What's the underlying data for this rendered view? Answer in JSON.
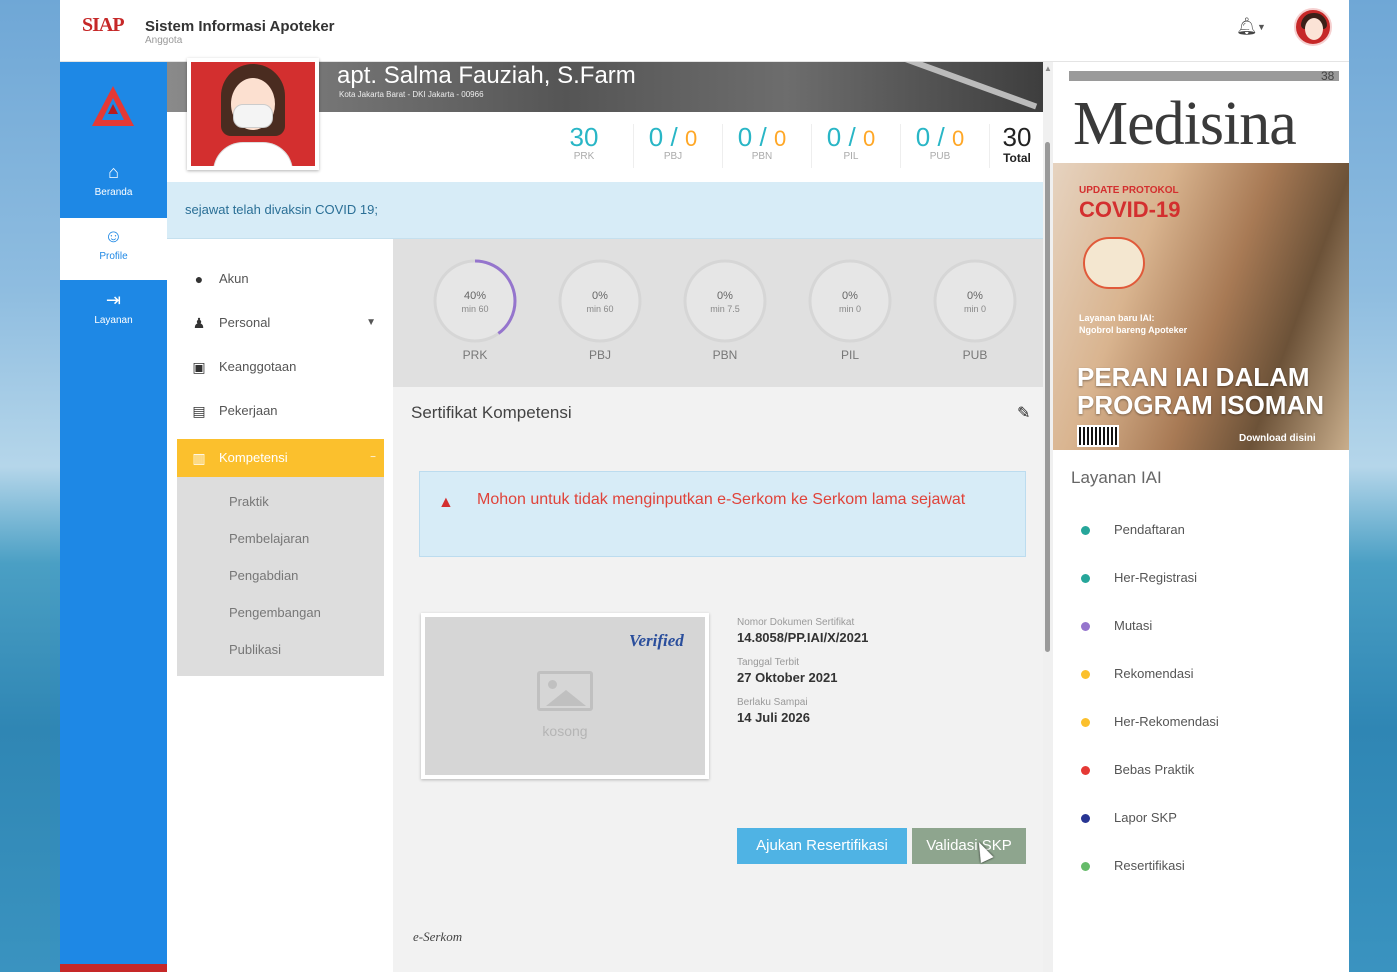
{
  "header": {
    "app_title": "Sistem Informasi Apoteker",
    "app_subtitle": "Anggota",
    "logo_text": "SIAP"
  },
  "nav": [
    {
      "label": "Beranda",
      "icon": "home-icon"
    },
    {
      "label": "Profile",
      "icon": "user-icon"
    },
    {
      "label": "Layanan",
      "icon": "sign-in-icon"
    }
  ],
  "profile": {
    "name": "apt. Salma Fauziah, S.Farm",
    "address": "Kota Jakarta Barat - DKI Jakarta - 00966"
  },
  "stats": [
    {
      "value": "30",
      "label": "PRK"
    },
    {
      "value": "0 / ",
      "sub": "0",
      "label": "PBJ"
    },
    {
      "value": "0 / ",
      "sub": "0",
      "label": "PBN"
    },
    {
      "value": "0 / ",
      "sub": "0",
      "label": "PIL"
    },
    {
      "value": "0 / ",
      "sub": "0",
      "label": "PUB"
    },
    {
      "value": "30",
      "label": "Total"
    }
  ],
  "banner_text": "sejawat telah divaksin COVID 19;",
  "menu": {
    "items": [
      {
        "label": "Akun",
        "icon": "user-circle-icon"
      },
      {
        "label": "Personal",
        "icon": "user-icon"
      },
      {
        "label": "Keanggotaan",
        "icon": "id-card-icon"
      },
      {
        "label": "Pekerjaan",
        "icon": "clipboard-icon"
      },
      {
        "label": "Kompetensi",
        "icon": "document-icon"
      }
    ],
    "submenu": [
      "Praktik",
      "Pembelajaran",
      "Pengabdian",
      "Pengembangan",
      "Publikasi"
    ]
  },
  "progress": [
    {
      "pct": "40%",
      "min": "min 60",
      "label": "PRK",
      "fraction": 0.4
    },
    {
      "pct": "0%",
      "min": "min 60",
      "label": "PBJ",
      "fraction": 0
    },
    {
      "pct": "0%",
      "min": "min 7.5",
      "label": "PBN",
      "fraction": 0
    },
    {
      "pct": "0%",
      "min": "min 0",
      "label": "PIL",
      "fraction": 0
    },
    {
      "pct": "0%",
      "min": "min 0",
      "label": "PUB",
      "fraction": 0
    }
  ],
  "serkom": {
    "title": "Sertifikat Kompetensi",
    "alert": "Mohon untuk tidak menginputkan e-Serkom ke Serkom lama sejawat",
    "image_placeholder": "kosong",
    "verified_stamp": "Verified",
    "fields": [
      {
        "label": "Nomor Dokumen Sertifikat",
        "value": "14.8058/PP.IAI/X/2021"
      },
      {
        "label": "Tanggal Terbit",
        "value": "27 Oktober 2021"
      },
      {
        "label": "Berlaku Sampai",
        "value": "14 Juli 2026"
      }
    ],
    "btn_resertifikasi": "Ajukan Resertifikasi",
    "btn_validasi": "Validasi SKP",
    "footer": "e-Serkom"
  },
  "magazine": {
    "issue": "38",
    "title": "Medisina",
    "update": "UPDATE PROTOKOL",
    "covid": "COVID-19",
    "layanan": "Layanan baru IAI:",
    "layanan2": "Ngobrol bareng Apoteker",
    "headline_1": "PERAN IAI DALAM",
    "headline_2": "PROGRAM ISOMAN",
    "download": "Download disini"
  },
  "layanan_title": "Layanan IAI",
  "layanan": [
    {
      "label": "Pendaftaran",
      "color": "#26a69a"
    },
    {
      "label": "Her-Registrasi",
      "color": "#26a69a"
    },
    {
      "label": "Mutasi",
      "color": "#9575cd"
    },
    {
      "label": "Rekomendasi",
      "color": "#fbc02d"
    },
    {
      "label": "Her-Rekomendasi",
      "color": "#fbc02d"
    },
    {
      "label": "Bebas Praktik",
      "color": "#e53935"
    },
    {
      "label": "Lapor SKP",
      "color": "#283593"
    },
    {
      "label": "Resertifikasi",
      "color": "#66bb6a"
    }
  ],
  "colors": {
    "accent": "#1e88e5",
    "warning": "#fbc02d",
    "danger": "#d32f2f",
    "teal": "#29b6c6"
  }
}
